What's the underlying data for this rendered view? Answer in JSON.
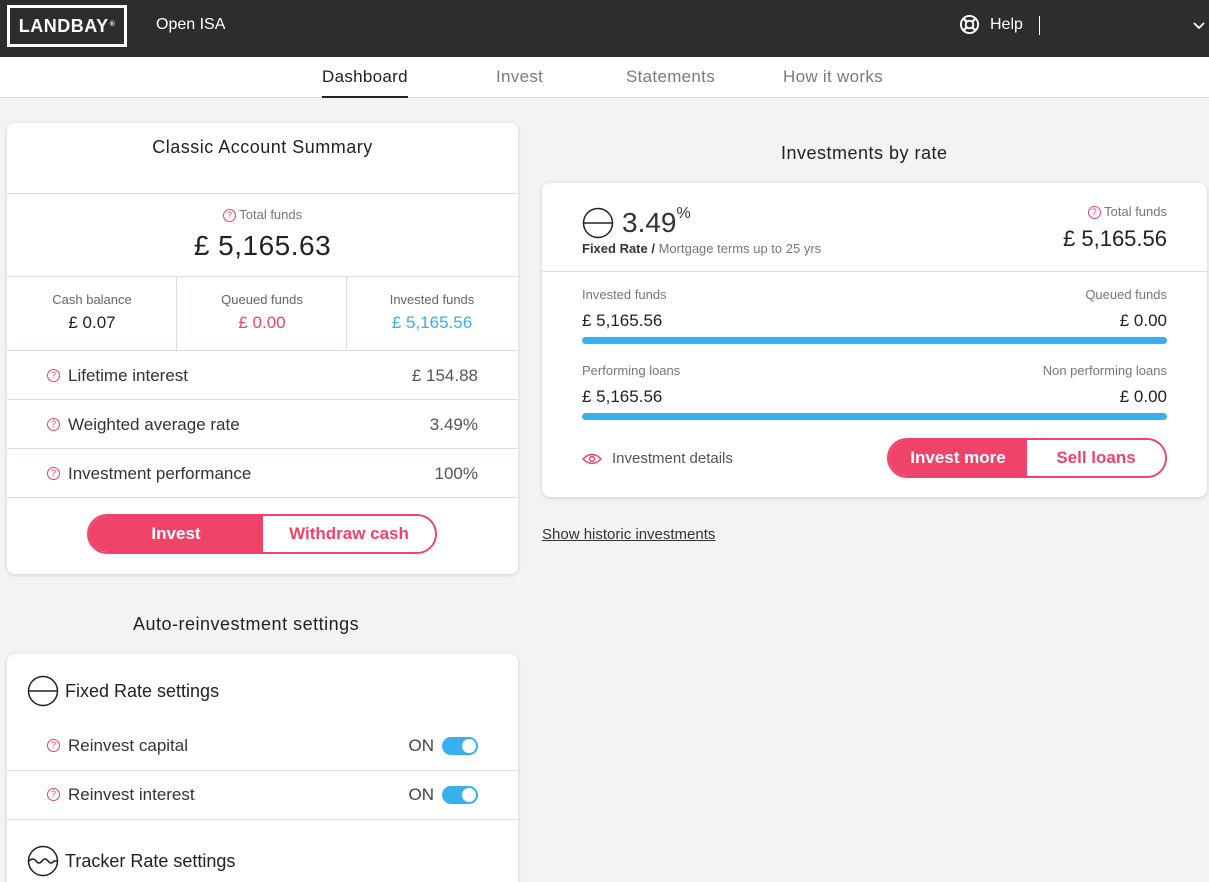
{
  "header": {
    "logo_text": "LANDBAY",
    "logo_mark": "®",
    "product": "Open ISA",
    "help_label": "Help"
  },
  "nav": {
    "tabs": [
      {
        "label": "Dashboard",
        "active": true
      },
      {
        "label": "Invest",
        "active": false
      },
      {
        "label": "Statements",
        "active": false
      },
      {
        "label": "How it works",
        "active": false
      }
    ]
  },
  "summary": {
    "title": "Classic Account Summary",
    "total_label": "Total funds",
    "total_value": "£ 5,165.63",
    "cash_label": "Cash balance",
    "cash_value": "£ 0.07",
    "queued_label": "Queued funds",
    "queued_value": "£ 0.00",
    "invested_label": "Invested funds",
    "invested_value": "£ 5,165.56",
    "rows": [
      {
        "label": "Lifetime interest",
        "value": "£ 154.88"
      },
      {
        "label": "Weighted average rate",
        "value": "3.49%"
      },
      {
        "label": "Investment performance",
        "value": "100%"
      }
    ],
    "invest_button": "Invest",
    "withdraw_button": "Withdraw cash"
  },
  "rates": {
    "section_title": "Investments by rate",
    "rate_value": "3.49",
    "rate_unit": "%",
    "rate_type": "Fixed Rate /",
    "rate_terms": "Mortgage terms up to 25 yrs",
    "total_label": "Total funds",
    "total_value": "£ 5,165.56",
    "invested_label": "Invested funds",
    "invested_value": "£ 5,165.56",
    "queued_label": "Queued funds",
    "queued_value": "£ 0.00",
    "performing_label": "Performing loans",
    "performing_value": "£ 5,165.56",
    "nonperforming_label": "Non performing loans",
    "nonperforming_value": "£ 0.00",
    "details_link": "Investment details",
    "invest_more_button": "Invest more",
    "sell_button": "Sell loans",
    "history_link": "Show historic investments"
  },
  "auto": {
    "section_title": "Auto-reinvestment settings",
    "fixed_title": "Fixed Rate settings",
    "reinvest_capital_label": "Reinvest capital",
    "reinvest_capital_state": "ON",
    "reinvest_interest_label": "Reinvest interest",
    "reinvest_interest_state": "ON",
    "tracker_title": "Tracker Rate settings"
  },
  "colors": {
    "accent": "#f0436a",
    "bar": "#36b0ee",
    "topbar": "#2d2d2d"
  }
}
